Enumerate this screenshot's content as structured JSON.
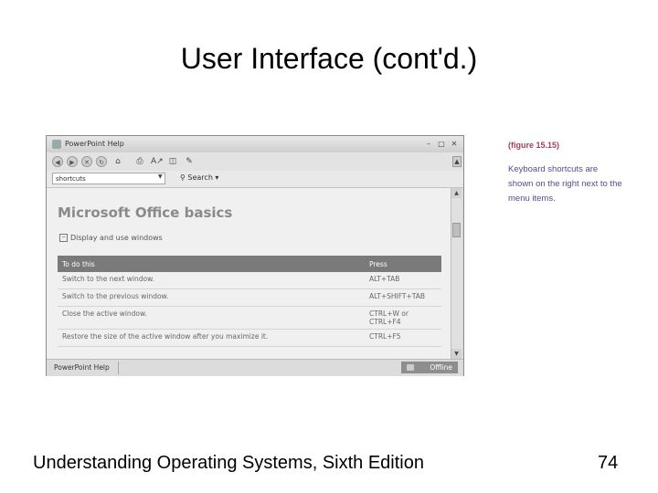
{
  "slide": {
    "title": "User Interface (cont'd.)",
    "footer": "Understanding Operating Systems, Sixth Edition",
    "page_number": "74"
  },
  "window": {
    "title": "PowerPoint Help",
    "minimize_icon": "minimize-icon",
    "maximize_icon": "maximize-icon",
    "close_icon": "close-icon"
  },
  "toolbar": {
    "icons": [
      "back-icon",
      "forward-icon",
      "stop-icon",
      "refresh-icon",
      "home-icon",
      "print-icon",
      "font-size-icon",
      "book-icon",
      "pin-icon"
    ]
  },
  "search": {
    "value": "shortcuts",
    "button_label": "Search"
  },
  "content": {
    "heading": "Microsoft Office basics",
    "section": "Display and use windows",
    "table": {
      "headers": [
        "To do this",
        "Press"
      ],
      "rows": [
        [
          "Switch to the next window.",
          "ALT+TAB"
        ],
        [
          "Switch to the previous window.",
          "ALT+SHIFT+TAB"
        ],
        [
          "Close the active window.",
          "CTRL+W or\nCTRL+F4"
        ],
        [
          "Restore the size of the active window after you maximize it.",
          "CTRL+F5"
        ]
      ]
    }
  },
  "statusbar": {
    "left": "PowerPoint Help",
    "offline": "Offline"
  },
  "caption": {
    "figure": "(figure 15.15)",
    "text": "Keyboard shortcuts are shown on the right next to the menu items."
  },
  "colors": {
    "table_header": "#7a7a7a",
    "caption_figure": "#a0415c",
    "caption_text": "#5a4a8a"
  }
}
